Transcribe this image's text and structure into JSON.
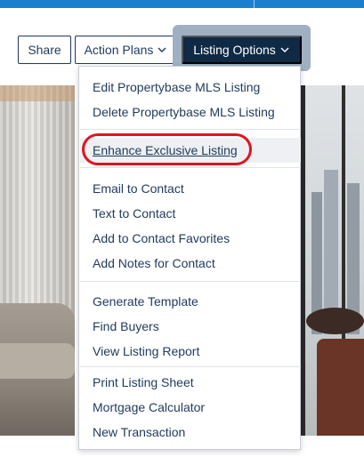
{
  "toolbar": {
    "share_label": "Share",
    "action_plans_label": "Action Plans",
    "listing_options_label": "Listing Options"
  },
  "menu": {
    "items": [
      {
        "label": "Edit Propertybase MLS Listing"
      },
      {
        "label": "Delete Propertybase MLS Listing"
      },
      {
        "label": "Enhance Exclusive Listing"
      },
      {
        "label": "Email to Contact"
      },
      {
        "label": "Text to Contact"
      },
      {
        "label": "Add to Contact Favorites"
      },
      {
        "label": "Add Notes for Contact"
      },
      {
        "label": "Generate Template"
      },
      {
        "label": "Find Buyers"
      },
      {
        "label": "View Listing Report"
      },
      {
        "label": "Print Listing Sheet"
      },
      {
        "label": "Mortgage Calculator"
      },
      {
        "label": "New Transaction"
      }
    ]
  },
  "icons": {
    "action_plans_chevron": "chevron-down-icon",
    "listing_options_chevron": "chevron-down-icon"
  },
  "colors": {
    "brand_blue": "#1b7fd0",
    "navy": "#0f2a45",
    "link": "#1e3a5c",
    "annotation_red": "#e0141d"
  }
}
